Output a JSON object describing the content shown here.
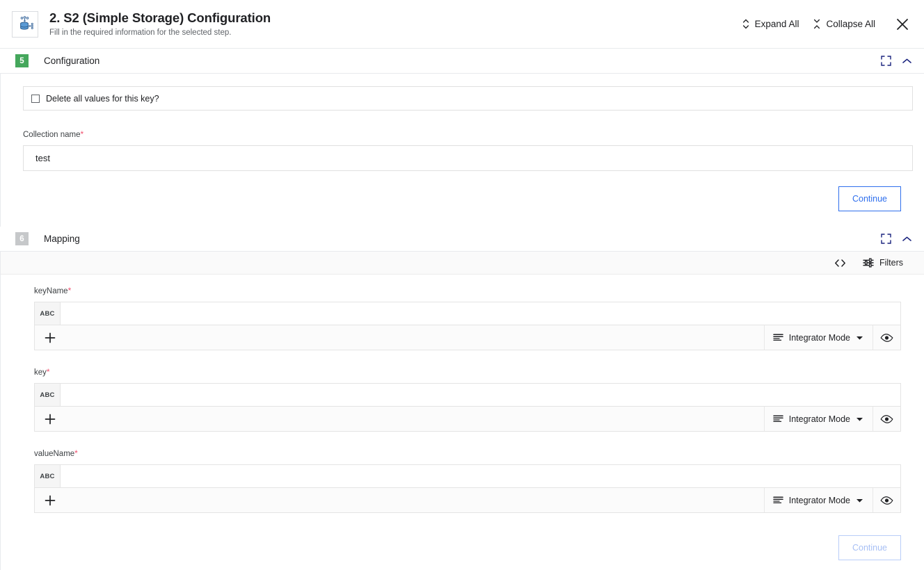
{
  "header": {
    "icon": "database-storage-icon",
    "title": "2. S2 (Simple Storage) Configuration",
    "subtitle": "Fill in the required information for the selected step.",
    "expand_all_label": "Expand All",
    "expand_all_icon": "expand-vertical-icon",
    "collapse_all_label": "Collapse All",
    "collapse_all_icon": "collapse-vertical-icon",
    "close_icon": "close-icon"
  },
  "colors": {
    "badge_active": "#45a75c",
    "badge_inactive": "#c6c8ca",
    "accent": "#2f6fed",
    "required_asterisk": "#f0506e"
  },
  "configuration_panel": {
    "step_number": "5",
    "title": "Configuration",
    "fullscreen_icon": "fullscreen-icon",
    "collapse_icon": "chevron-up-icon",
    "checkbox": {
      "label": "Delete all values for this key?",
      "checked": false
    },
    "collection_name": {
      "label": "Collection name",
      "required": "*",
      "value": "test",
      "placeholder": ""
    },
    "continue_label": "Continue"
  },
  "mapping_panel": {
    "step_number": "6",
    "title": "Mapping",
    "fullscreen_icon": "fullscreen-icon",
    "collapse_icon": "chevron-up-icon",
    "toolbar": {
      "code_icon": "code-brackets-icon",
      "filters_icon": "filters-icon",
      "filters_label": "Filters"
    },
    "fields": [
      {
        "label": "keyName",
        "required": "*",
        "column_type": "ABC",
        "value": "",
        "add_icon": "plus-icon",
        "mode_icon": "list-lines-icon",
        "mode_label": "Integrator Mode",
        "mode_caret": "caret-down-icon",
        "preview_icon": "eye-icon"
      },
      {
        "label": "key",
        "required": "*",
        "column_type": "ABC",
        "value": "",
        "add_icon": "plus-icon",
        "mode_icon": "list-lines-icon",
        "mode_label": "Integrator Mode",
        "mode_caret": "caret-down-icon",
        "preview_icon": "eye-icon"
      },
      {
        "label": "valueName",
        "required": "*",
        "column_type": "ABC",
        "value": "",
        "add_icon": "plus-icon",
        "mode_icon": "list-lines-icon",
        "mode_label": "Integrator Mode",
        "mode_caret": "caret-down-icon",
        "preview_icon": "eye-icon"
      }
    ],
    "continue_label": "Continue",
    "continue_disabled": true
  }
}
